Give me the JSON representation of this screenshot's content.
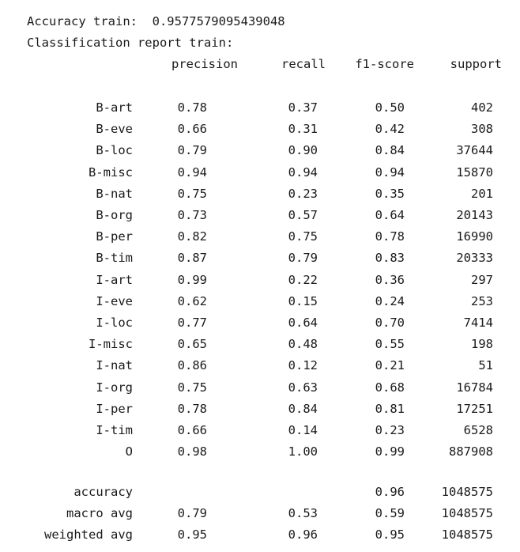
{
  "accuracy_line": "Accuracy train:  0.9577579095439048",
  "report_title": "Classification report train:",
  "headers": {
    "precision": "precision",
    "recall": "recall",
    "f1": "f1-score",
    "support": "support"
  },
  "rows": [
    {
      "label": "B-art",
      "precision": "0.78",
      "recall": "0.37",
      "f1": "0.50",
      "support": "402"
    },
    {
      "label": "B-eve",
      "precision": "0.66",
      "recall": "0.31",
      "f1": "0.42",
      "support": "308"
    },
    {
      "label": "B-loc",
      "precision": "0.79",
      "recall": "0.90",
      "f1": "0.84",
      "support": "37644"
    },
    {
      "label": "B-misc",
      "precision": "0.94",
      "recall": "0.94",
      "f1": "0.94",
      "support": "15870"
    },
    {
      "label": "B-nat",
      "precision": "0.75",
      "recall": "0.23",
      "f1": "0.35",
      "support": "201"
    },
    {
      "label": "B-org",
      "precision": "0.73",
      "recall": "0.57",
      "f1": "0.64",
      "support": "20143"
    },
    {
      "label": "B-per",
      "precision": "0.82",
      "recall": "0.75",
      "f1": "0.78",
      "support": "16990"
    },
    {
      "label": "B-tim",
      "precision": "0.87",
      "recall": "0.79",
      "f1": "0.83",
      "support": "20333"
    },
    {
      "label": "I-art",
      "precision": "0.99",
      "recall": "0.22",
      "f1": "0.36",
      "support": "297"
    },
    {
      "label": "I-eve",
      "precision": "0.62",
      "recall": "0.15",
      "f1": "0.24",
      "support": "253"
    },
    {
      "label": "I-loc",
      "precision": "0.77",
      "recall": "0.64",
      "f1": "0.70",
      "support": "7414"
    },
    {
      "label": "I-misc",
      "precision": "0.65",
      "recall": "0.48",
      "f1": "0.55",
      "support": "198"
    },
    {
      "label": "I-nat",
      "precision": "0.86",
      "recall": "0.12",
      "f1": "0.21",
      "support": "51"
    },
    {
      "label": "I-org",
      "precision": "0.75",
      "recall": "0.63",
      "f1": "0.68",
      "support": "16784"
    },
    {
      "label": "I-per",
      "precision": "0.78",
      "recall": "0.84",
      "f1": "0.81",
      "support": "17251"
    },
    {
      "label": "I-tim",
      "precision": "0.66",
      "recall": "0.14",
      "f1": "0.23",
      "support": "6528"
    },
    {
      "label": "O",
      "precision": "0.98",
      "recall": "1.00",
      "f1": "0.99",
      "support": "887908"
    }
  ],
  "summary": [
    {
      "label": "accuracy",
      "precision": "",
      "recall": "",
      "f1": "0.96",
      "support": "1048575"
    },
    {
      "label": "macro avg",
      "precision": "0.79",
      "recall": "0.53",
      "f1": "0.59",
      "support": "1048575"
    },
    {
      "label": "weighted avg",
      "precision": "0.95",
      "recall": "0.96",
      "f1": "0.95",
      "support": "1048575"
    }
  ]
}
